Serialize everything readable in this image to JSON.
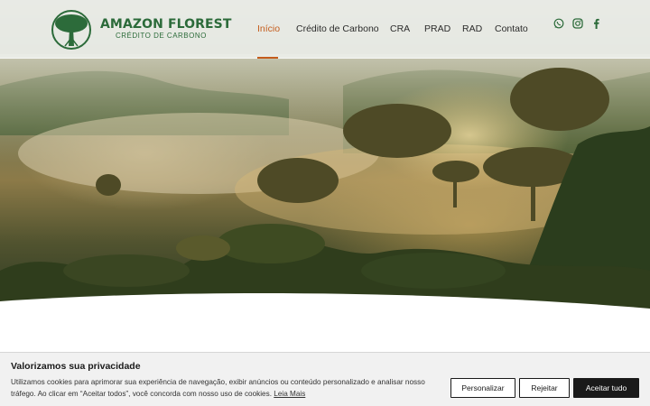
{
  "brand": {
    "title": "AMAZON FLOREST",
    "subtitle": "CRÉDITO DE CARBONO",
    "color": "#2c6b3a"
  },
  "nav": {
    "items": [
      {
        "label": "Início",
        "active": true
      },
      {
        "label": "Crédito de Carbono",
        "active": false
      },
      {
        "label": "CRA",
        "active": false
      },
      {
        "label": "PRAD",
        "active": false
      },
      {
        "label": "RAD",
        "active": false
      },
      {
        "label": "Contato",
        "active": false
      }
    ],
    "active_color": "#c45c1c"
  },
  "social": {
    "icons": [
      "whatsapp-icon",
      "instagram-icon",
      "facebook-icon"
    ],
    "color": "#2c6b3a"
  },
  "hero": {
    "image": "misty-rainforest-icon"
  },
  "cookie": {
    "title": "Valorizamos sua privacidade",
    "text": "Utilizamos cookies para aprimorar sua experiência de navegação, exibir anúncios ou conteúdo personalizado e analisar nosso tráfego. Ao clicar em “Aceitar todos”, você concorda com nosso uso de cookies.",
    "link": "Leia Mais",
    "buttons": {
      "customize": "Personalizar",
      "reject": "Rejeitar",
      "accept": "Aceitar tudo"
    }
  }
}
